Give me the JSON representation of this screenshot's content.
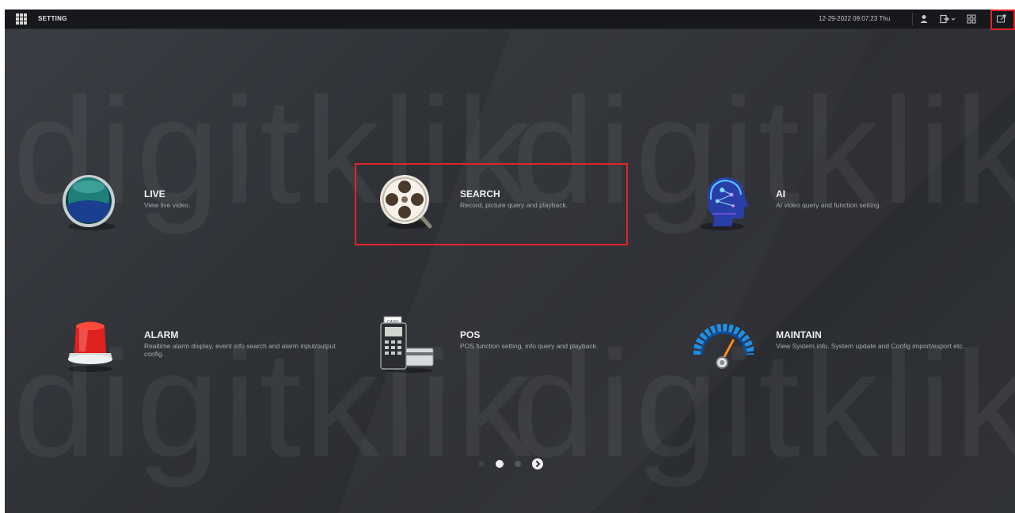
{
  "topbar": {
    "title": "SETTING",
    "datetime": "12-29-2022 09:07:23 Thu"
  },
  "tiles": [
    {
      "name": "LIVE",
      "desc": "View live video.",
      "icon": "live-icon"
    },
    {
      "name": "SEARCH",
      "desc": "Record, picture query and playback.",
      "icon": "search-reel-icon"
    },
    {
      "name": "AI",
      "desc": "AI video query and function setting.",
      "icon": "ai-head-icon"
    },
    {
      "name": "ALARM",
      "desc": "Realtime alarm display, event info search and alarm input/output config.",
      "icon": "alarm-siren-icon"
    },
    {
      "name": "POS",
      "desc": "POS function setting, info query and playback.",
      "icon": "pos-terminal-icon"
    },
    {
      "name": "MAINTAIN",
      "desc": "View System info, System update and Config import/export etc.",
      "icon": "gauge-icon"
    }
  ],
  "pagination": {
    "current_page": 2,
    "total_pages": 3
  },
  "watermark": "digitklik",
  "colors": {
    "highlight": "#e2242b",
    "background": "#2f3237",
    "topbar": "#17181b"
  }
}
